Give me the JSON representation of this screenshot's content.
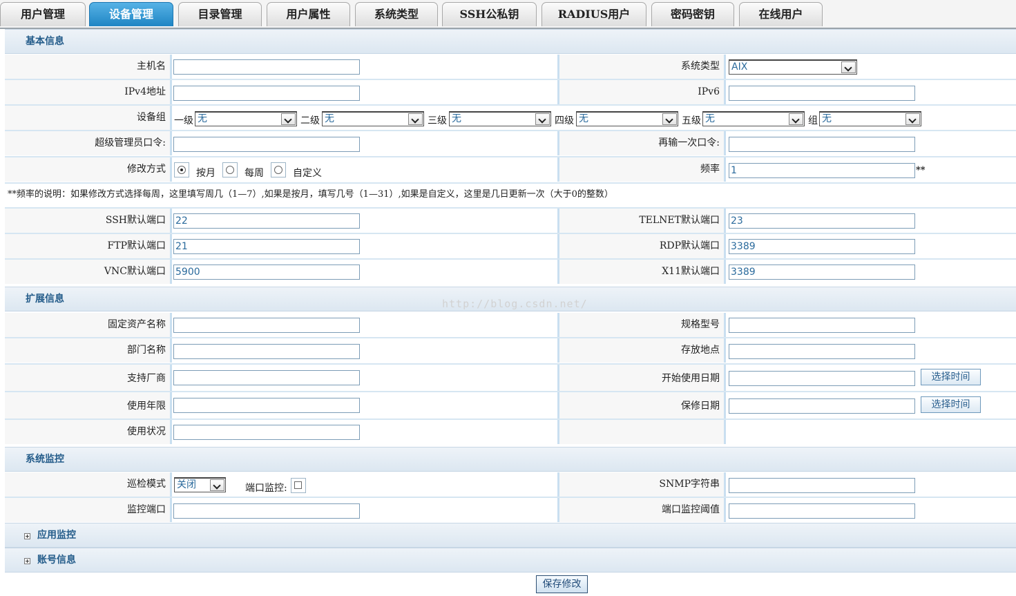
{
  "tabs": [
    {
      "label": "用户管理",
      "active": false
    },
    {
      "label": "设备管理",
      "active": true
    },
    {
      "label": "目录管理",
      "active": false
    },
    {
      "label": "用户属性",
      "active": false
    },
    {
      "label": "系统类型",
      "active": false
    },
    {
      "label": "SSH公私钥",
      "active": false
    },
    {
      "label": "RADIUS用户",
      "active": false
    },
    {
      "label": "密码密钥",
      "active": false
    },
    {
      "label": "在线用户",
      "active": false
    }
  ],
  "basic": {
    "title": "基本信息",
    "hostname_label": "主机名",
    "hostname_value": "",
    "systype_label": "系统类型",
    "systype_value": "AIX",
    "ipv4_label": "IPv4地址",
    "ipv4_value": "",
    "ipv6_label": "IPv6",
    "ipv6_value": "",
    "group_label": "设备组",
    "groups": [
      {
        "label": "一级",
        "value": "无"
      },
      {
        "label": "二级",
        "value": "无"
      },
      {
        "label": "三级",
        "value": "无"
      },
      {
        "label": "四级",
        "value": "无"
      },
      {
        "label": "五级",
        "value": "无"
      },
      {
        "label": "组",
        "value": "无"
      }
    ],
    "superpw_label": "超级管理员口令:",
    "superpw_value": "",
    "repw_label": "再输一次口令:",
    "repw_value": "",
    "mode_label": "修改方式",
    "mode_options": [
      {
        "label": "按月",
        "checked": true
      },
      {
        "label": "每周",
        "checked": false
      },
      {
        "label": "自定义",
        "checked": false
      }
    ],
    "freq_label": "频率",
    "freq_value": "1",
    "freq_suffix": "**",
    "note": "**频率的说明：如果修改方式选择每周，这里填写周几（1—7）,如果是按月，填写几号（1—31）,如果是自定义，这里是几日更新一次（大于0的整数）",
    "ssh_label": "SSH默认端口",
    "ssh_value": "22",
    "telnet_label": "TELNET默认端口",
    "telnet_value": "23",
    "ftp_label": "FTP默认端口",
    "ftp_value": "21",
    "rdp_label": "RDP默认端口",
    "rdp_value": "3389",
    "vnc_label": "VNC默认端口",
    "vnc_value": "5900",
    "x11_label": "X11默认端口",
    "x11_value": "3389"
  },
  "extended": {
    "title": "扩展信息",
    "asset_label": "固定资产名称",
    "asset_value": "",
    "spec_label": "规格型号",
    "spec_value": "",
    "dept_label": "部门名称",
    "dept_value": "",
    "location_label": "存放地点",
    "location_value": "",
    "vendor_label": "支持厂商",
    "vendor_value": "",
    "start_label": "开始使用日期",
    "start_value": "",
    "years_label": "使用年限",
    "years_value": "",
    "warranty_label": "保修日期",
    "warranty_value": "",
    "status_label": "使用状况",
    "status_value": "",
    "pick_time": "选择时间"
  },
  "monitor": {
    "title": "系统监控",
    "patrol_label": "巡检模式",
    "patrol_value": "关闭",
    "portmon_label": "端口监控:",
    "snmp_label": "SNMP字符串",
    "snmp_value": "",
    "monport_label": "监控端口",
    "monport_value": "",
    "threshold_label": "端口监控阈值",
    "threshold_value": ""
  },
  "collapsed": {
    "app_monitor": "应用监控",
    "account_info": "账号信息"
  },
  "save_label": "保存修改",
  "watermark": "http://blog.csdn.net/"
}
